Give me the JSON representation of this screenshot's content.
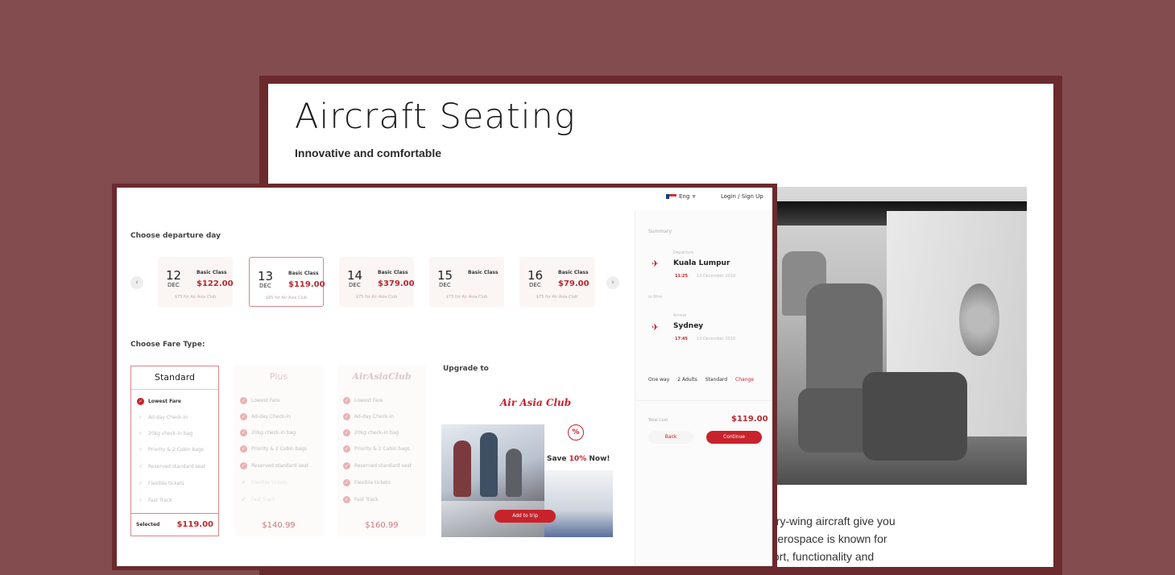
{
  "back_page": {
    "title": "Aircraft Seating",
    "subtitle": "Innovative and comfortable",
    "body_text": "ary-wing aircraft give you\nAerospace is known for\nfort, functionality and"
  },
  "app": {
    "topbar": {
      "language": "Eng",
      "login": "Login / Sign Up"
    },
    "departure": {
      "label": "Choose departure day",
      "days": [
        {
          "day": "12",
          "month": "DEC",
          "class": "Basic Class",
          "price": "$122.00",
          "club": "$75 for Air Asia Club"
        },
        {
          "day": "13",
          "month": "DEC",
          "class": "Basic Class",
          "price": "$119.00",
          "club": "$95 for Air Asia Club"
        },
        {
          "day": "14",
          "month": "DEC",
          "class": "Basic Class",
          "price": "$379.00",
          "club": "$75 for Air Asia Club"
        },
        {
          "day": "15",
          "month": "DEC",
          "class": "Basic Class",
          "price": "",
          "club": "$75 for Air Asia Club"
        },
        {
          "day": "16",
          "month": "DEC",
          "class": "Basic Class",
          "price": "$79.00",
          "club": "$75 for Air Asia Club"
        }
      ]
    },
    "fare": {
      "label": "Choose Fare Type:",
      "standard": {
        "name": "Standard",
        "features": [
          "Lowest Fare",
          "Ad-day Check-in",
          "20kg check-in bag",
          "Priority & 2 Cabin bags",
          "Reserved standard seat",
          "Flexible tickets",
          "Fast Track"
        ],
        "footer_label": "Selected",
        "price": "$119.00"
      },
      "plus": {
        "name": "Plus",
        "features": [
          "Lowest Fare",
          "Ad-day Check-in",
          "20kg check-in bag",
          "Priority & 2 Cabin bags",
          "Reserved standard seat",
          "Flexible tickets",
          "Fast Track"
        ],
        "price": "$140.99"
      },
      "club": {
        "name": "AirAsiaClub",
        "features": [
          "Lowest Fare",
          "Ad-day Check-in",
          "20kg check-in bag",
          "Priority & 2 Cabin bags",
          "Reserved standard seat",
          "Flexible tickets",
          "Fast Track"
        ],
        "price": "$160.99"
      }
    },
    "upgrade": {
      "label": "Upgrade to",
      "club_logo": "Air Asia Club",
      "save_prefix": "Save ",
      "save_pct": "10%",
      "save_suffix": " Now!",
      "button": "Add to trip",
      "icon": "percent-badge-icon"
    },
    "summary": {
      "label": "Summary",
      "departure_sub": "Departure",
      "departure_city": "Kuala Lumpur",
      "departure_time": "11:25",
      "departure_date": "13 December 2018",
      "inline_label": "in 8hrs",
      "arrival_sub": "Arrival",
      "arrival_city": "Sydney",
      "arrival_time": "17:45",
      "arrival_date": "13 December 2018",
      "trip_type": "One way",
      "passengers": "2 Adults",
      "fare_type": "Standard",
      "change": "Change",
      "total_label": "Total Cost",
      "total": "$119.00",
      "back": "Back",
      "continue": "Continue"
    },
    "colors": {
      "accent": "#c8232c",
      "price": "#b82a2e",
      "frame": "#6a2a2e",
      "background": "#834c4f"
    }
  }
}
